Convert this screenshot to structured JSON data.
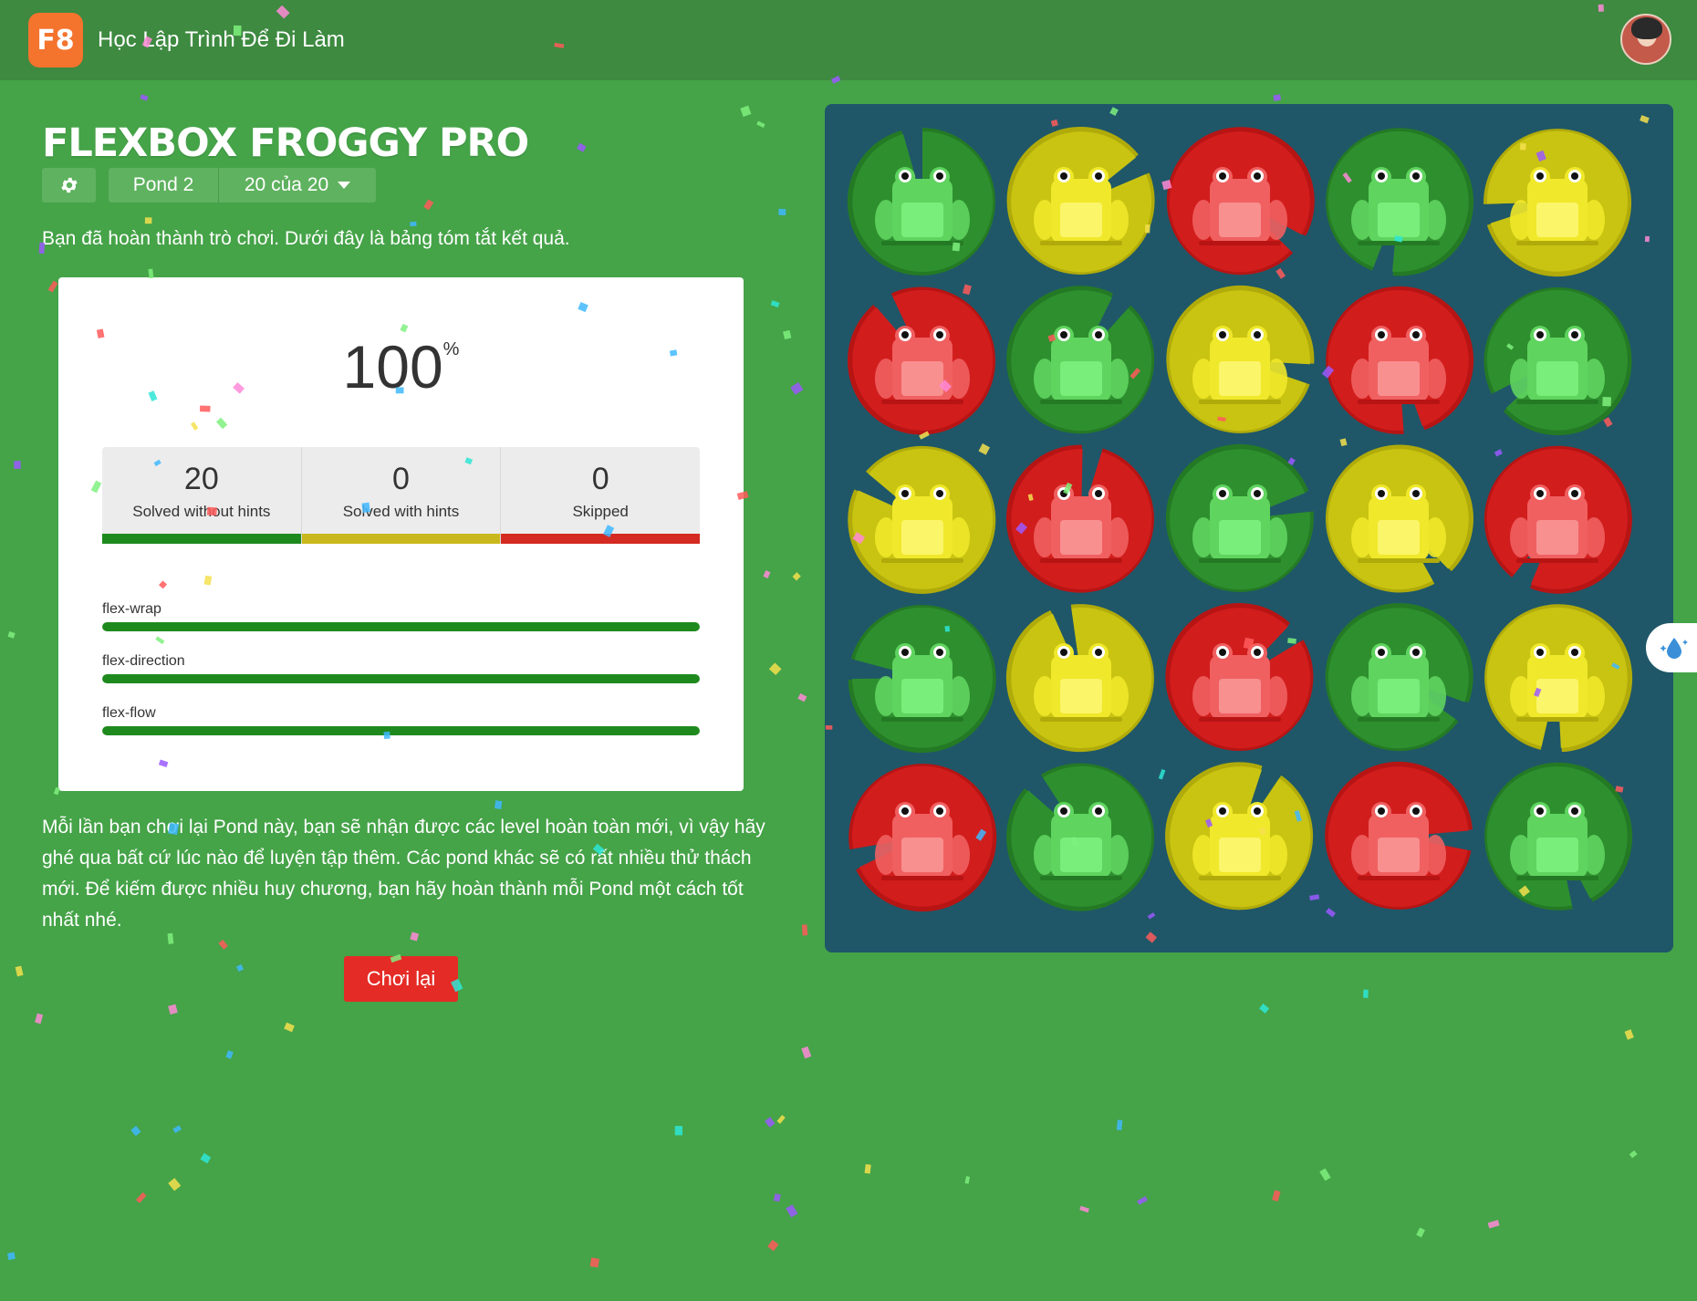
{
  "header": {
    "logo_text": "F8",
    "brand": "Học Lập Trình Để Đi Làm"
  },
  "game": {
    "title": "FLEXBOX FROGGY PRO",
    "pond_label": "Pond 2",
    "level_label": "20 của 20",
    "settings_icon": "gear-icon",
    "completion_message": "Bạn đã hoàn thành trò chơi. Dưới đây là bảng tóm tắt kết quả."
  },
  "results": {
    "percent": "100",
    "percent_sign": "%",
    "stats": [
      {
        "value": "20",
        "label": "Solved without hints",
        "color": "#1e8a1e"
      },
      {
        "value": "0",
        "label": "Solved with hints",
        "color": "#c9b81d"
      },
      {
        "value": "0",
        "label": "Skipped",
        "color": "#d42a22"
      }
    ],
    "properties": [
      {
        "name": "flex-wrap",
        "progress": 1.0
      },
      {
        "name": "flex-direction",
        "progress": 1.0
      },
      {
        "name": "flex-flow",
        "progress": 1.0
      }
    ]
  },
  "description": "Mỗi lần bạn chơi lại Pond này, bạn sẽ nhận được các level hoàn toàn mới, vì vậy hãy ghé qua bất cứ lúc nào để luyện tập thêm. Các pond khác sẽ có rất nhiều thử thách mới. Để kiếm được nhiều huy chương, bạn hãy hoàn thành mỗi Pond một cách tốt nhất nhé.",
  "replay_button": "Chơi lại",
  "board": {
    "rows": [
      [
        "green",
        "yellow",
        "red",
        "green",
        "yellow"
      ],
      [
        "red",
        "green",
        "yellow",
        "red",
        "green"
      ],
      [
        "yellow",
        "red",
        "green",
        "yellow",
        "red"
      ],
      [
        "green",
        "yellow",
        "red",
        "green",
        "yellow"
      ],
      [
        "red",
        "green",
        "yellow",
        "red",
        "green"
      ]
    ],
    "colors": {
      "green": {
        "pad": "#2e8f2e",
        "padDark": "#247a24",
        "frog": "#5fd45f",
        "belly": "#7aee7a"
      },
      "yellow": {
        "pad": "#c9c412",
        "padDark": "#b0ab0a",
        "frog": "#f0e82a",
        "belly": "#fbf56a"
      },
      "red": {
        "pad": "#d21d1d",
        "padDark": "#b71414",
        "frog": "#f06060",
        "belly": "#f89090"
      }
    }
  },
  "side_button_icon": "water-drop-icon"
}
